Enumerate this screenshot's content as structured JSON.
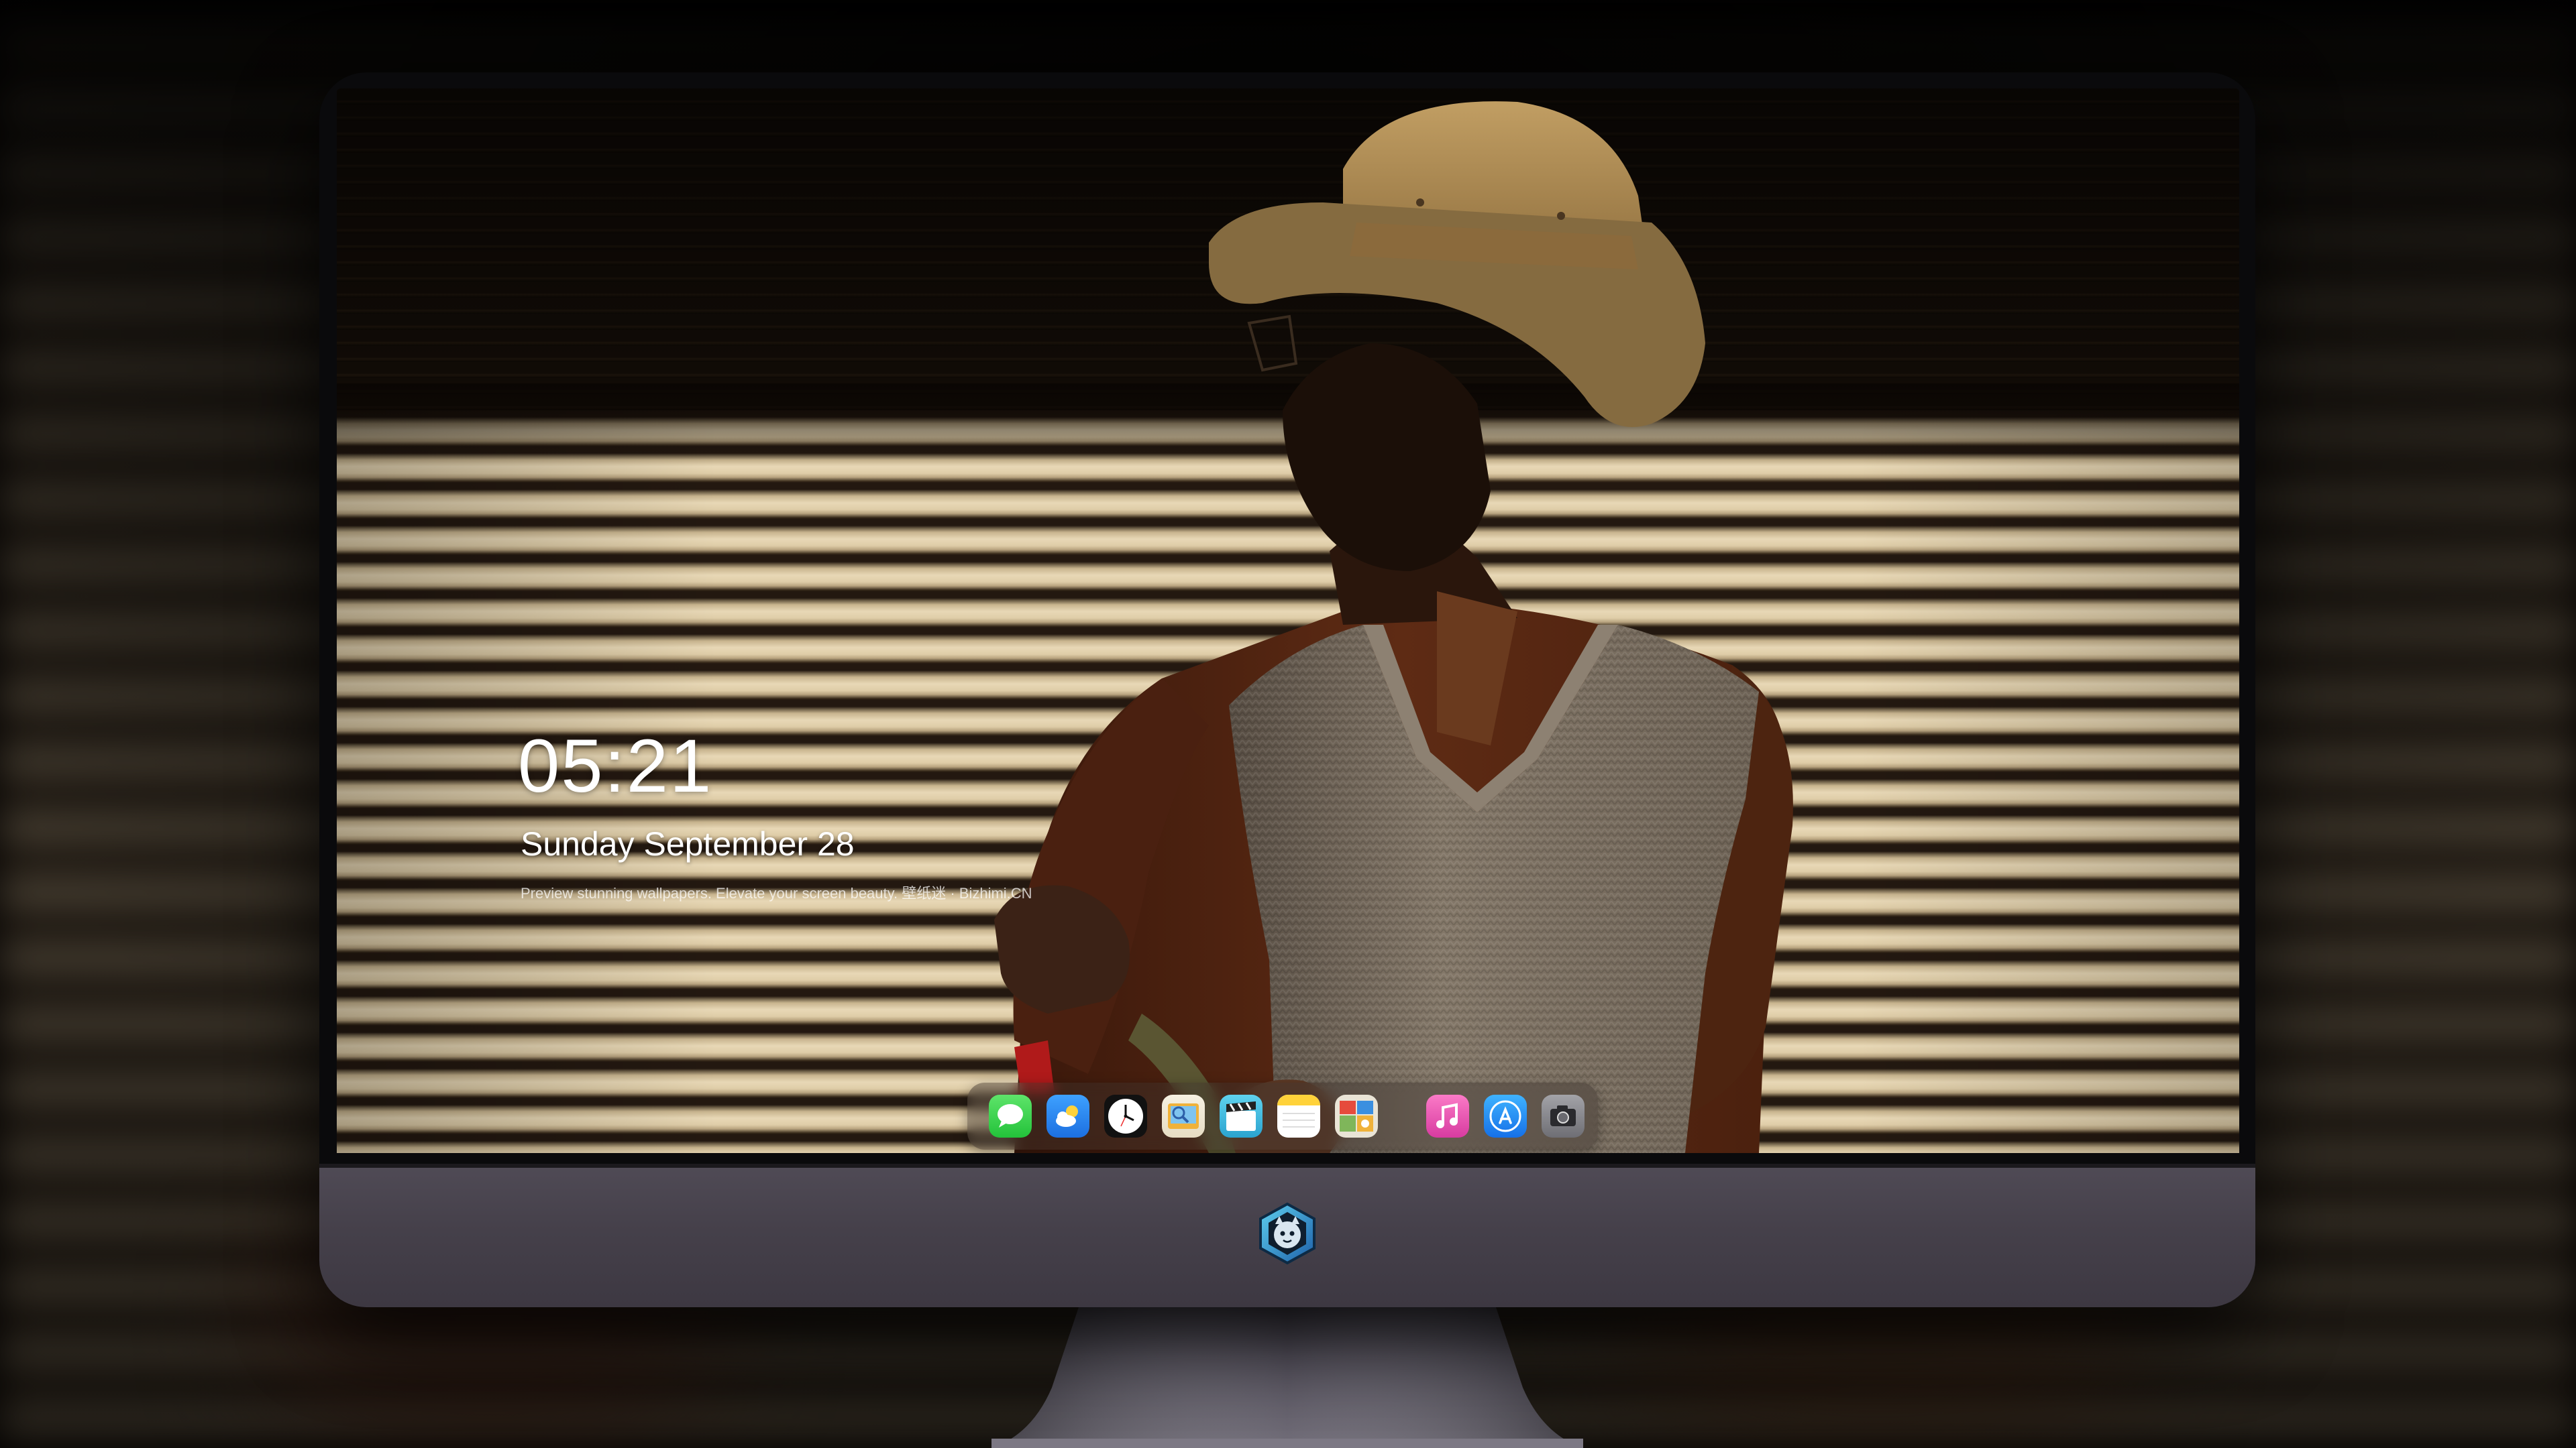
{
  "lock_screen": {
    "time": "05:21",
    "date": "Sunday September  28",
    "caption": "Preview stunning wallpapers. Elevate your screen beauty. 壁纸迷 · Bizhimi.CN"
  },
  "dock": {
    "apps": [
      {
        "name": "messages-app-icon",
        "icon": "speech-bubble",
        "color": "#3ad64a"
      },
      {
        "name": "weather-app-icon",
        "icon": "cloud-sun",
        "color": "#2d8ff0"
      },
      {
        "name": "clock-app-icon",
        "icon": "clock",
        "color": "#ffffff"
      },
      {
        "name": "preview-app-icon",
        "icon": "photo-viewer",
        "color": "#f0b23a"
      },
      {
        "name": "clips-app-icon",
        "icon": "clapperboard",
        "color": "#3fb8d9"
      },
      {
        "name": "notes-app-icon",
        "icon": "notepad",
        "color": "#ffd23a"
      },
      {
        "name": "photo-gallery-app-icon",
        "icon": "image-collage",
        "color": "#7fb65a"
      },
      {
        "name": "music-app-icon",
        "icon": "music-note",
        "color": "#f45fb6"
      },
      {
        "name": "app-store-icon",
        "icon": "app-store-a",
        "color": "#1a8ef5"
      },
      {
        "name": "camera-app-icon",
        "icon": "camera",
        "color": "#8e8e93"
      }
    ]
  },
  "colors": {
    "monitor_chin": "#48434e",
    "wall_shutter_light": "#e8d8b6",
    "sweater": "#7e7265",
    "shirt": "#5a2a14",
    "hat": "#a3834f"
  }
}
